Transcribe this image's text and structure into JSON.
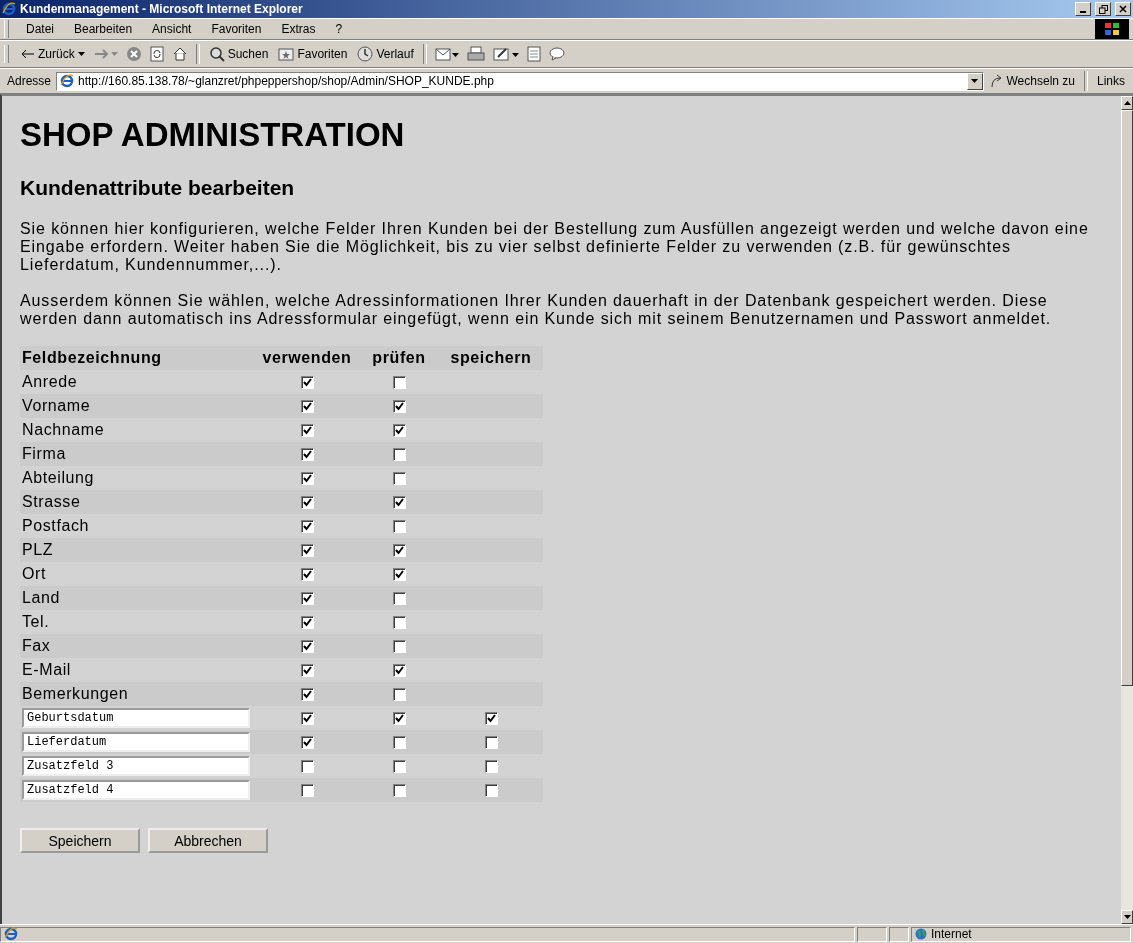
{
  "window": {
    "title": "Kundenmanagement - Microsoft Internet Explorer"
  },
  "menu": [
    "Datei",
    "Bearbeiten",
    "Ansicht",
    "Favoriten",
    "Extras",
    "?"
  ],
  "toolbar": {
    "back": "Zurück",
    "search": "Suchen",
    "favorites": "Favoriten",
    "history": "Verlauf"
  },
  "address_bar": {
    "label": "Adresse",
    "url": "http://160.85.138.78/~glanzret/phpeppershop/shop/Admin/SHOP_KUNDE.php",
    "go": "Wechseln zu",
    "links": "Links"
  },
  "page": {
    "heading": "SHOP ADMINISTRATION",
    "subheading": "Kundenattribute bearbeiten",
    "paragraphs": [
      "Sie können hier konfigurieren, welche Felder Ihren Kunden bei der Bestellung zum Ausfüllen angezeigt werden und welche davon eine Eingabe erfordern. Weiter haben Sie die Möglichkeit, bis zu vier selbst definierte Felder zu verwenden (z.B. für gewünschtes Lieferdatum, Kundennummer,...).",
      "Ausserdem können Sie wählen, welche Adressinformationen Ihrer Kunden dauerhaft in der Datenbank gespeichert werden. Diese werden dann automatisch ins Adressformular eingefügt, wenn ein Kunde sich mit seinem Benutzernamen und Passwort anmeldet."
    ],
    "table": {
      "columns": [
        "Feldbezeichnung",
        "verwenden",
        "prüfen",
        "speichern"
      ],
      "rows": [
        {
          "kind": "fixed",
          "label": "Anrede",
          "use": true,
          "check": false
        },
        {
          "kind": "fixed",
          "label": "Vorname",
          "use": true,
          "check": true
        },
        {
          "kind": "fixed",
          "label": "Nachname",
          "use": true,
          "check": true
        },
        {
          "kind": "fixed",
          "label": "Firma",
          "use": true,
          "check": false
        },
        {
          "kind": "fixed",
          "label": "Abteilung",
          "use": true,
          "check": false
        },
        {
          "kind": "fixed",
          "label": "Strasse",
          "use": true,
          "check": true
        },
        {
          "kind": "fixed",
          "label": "Postfach",
          "use": true,
          "check": false
        },
        {
          "kind": "fixed",
          "label": "PLZ",
          "use": true,
          "check": true
        },
        {
          "kind": "fixed",
          "label": "Ort",
          "use": true,
          "check": true
        },
        {
          "kind": "fixed",
          "label": "Land",
          "use": true,
          "check": false
        },
        {
          "kind": "fixed",
          "label": "Tel.",
          "use": true,
          "check": false
        },
        {
          "kind": "fixed",
          "label": "Fax",
          "use": true,
          "check": false
        },
        {
          "kind": "fixed",
          "label": "E-Mail",
          "use": true,
          "check": true
        },
        {
          "kind": "fixed",
          "label": "Bemerkungen",
          "use": true,
          "check": false
        },
        {
          "kind": "custom",
          "value": "Geburtsdatum",
          "use": true,
          "check": true,
          "store": true
        },
        {
          "kind": "custom",
          "value": "Lieferdatum",
          "use": true,
          "check": false,
          "store": false
        },
        {
          "kind": "custom",
          "value": "Zusatzfeld 3",
          "use": false,
          "check": false,
          "store": false
        },
        {
          "kind": "custom",
          "value": "Zusatzfeld 4",
          "use": false,
          "check": false,
          "store": false
        }
      ]
    },
    "buttons": [
      "Speichern",
      "Abbrechen"
    ]
  },
  "status_bar": {
    "zone": "Internet"
  }
}
